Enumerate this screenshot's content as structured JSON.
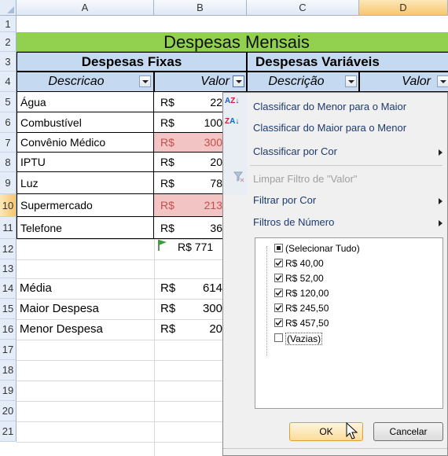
{
  "columns": [
    "A",
    "B",
    "C",
    "D"
  ],
  "rows": [
    "1",
    "2",
    "3",
    "4",
    "5",
    "6",
    "7",
    "8",
    "9",
    "10",
    "11",
    "12",
    "13",
    "14",
    "15",
    "16",
    "17",
    "18",
    "19",
    "20",
    "21"
  ],
  "title": "Despesas Mensais",
  "fixed_header": "Despesas Fixas",
  "variable_header": "Despesas Variáveis",
  "sub_headers": {
    "a": "Descricao",
    "b": "Valor",
    "c": "Descrição",
    "d": "Valor"
  },
  "currency": "R$",
  "expenses": [
    {
      "desc": "Água",
      "val": "22",
      "highlight": false
    },
    {
      "desc": "Combustível",
      "val": "100",
      "highlight": false
    },
    {
      "desc": "Convênio Médico",
      "val": "300",
      "highlight": true
    },
    {
      "desc": "IPTU",
      "val": "20",
      "highlight": false
    },
    {
      "desc": "Luz",
      "val": "78",
      "highlight": false
    },
    {
      "desc": "Supermercado",
      "val": "213",
      "highlight": true
    },
    {
      "desc": "Telefone",
      "val": "36",
      "highlight": false
    }
  ],
  "total": "R$ 771",
  "stats": [
    {
      "label": "Média",
      "val": "614"
    },
    {
      "label": "Maior Despesa",
      "val": "300"
    },
    {
      "label": "Menor Despesa",
      "val": "20"
    }
  ],
  "menu": {
    "sort_asc": "Classificar do Menor para o Maior",
    "sort_desc": "Classificar do Maior para o Menor",
    "sort_color": "Classificar por Cor",
    "clear_filter": "Limpar Filtro de \"Valor\"",
    "filter_color": "Filtrar por Cor",
    "number_filters": "Filtros de Número",
    "options": [
      {
        "label": "(Selecionar Tudo)",
        "state": "partial"
      },
      {
        "label": "R$ 40,00",
        "state": "checked"
      },
      {
        "label": "R$ 52,00",
        "state": "checked"
      },
      {
        "label": "R$ 120,00",
        "state": "checked"
      },
      {
        "label": "R$ 245,50",
        "state": "checked"
      },
      {
        "label": "R$ 457,50",
        "state": "checked"
      },
      {
        "label": "(Vazias)",
        "state": "unchecked"
      }
    ],
    "ok": "OK",
    "cancel": "Cancelar"
  },
  "colors": {
    "title_bg": "#92d050",
    "header_bg": "#c5d9f1",
    "highlight_bg": "#f2c4c4",
    "accent": "#1d3a6e"
  }
}
